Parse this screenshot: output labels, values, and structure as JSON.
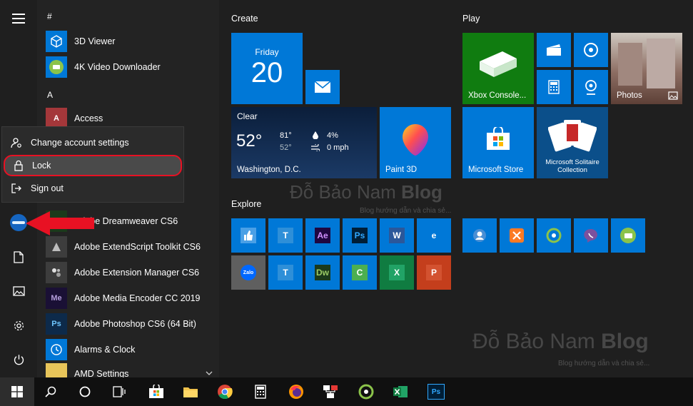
{
  "app_list": {
    "sections": {
      "hash": "#",
      "a": "A"
    },
    "items": [
      {
        "label": "3D Viewer",
        "icon": "cube-icon"
      },
      {
        "label": "4K Video Downloader",
        "icon": "download-icon"
      },
      {
        "label": "Access",
        "icon": "access-icon",
        "badge": "A"
      },
      {
        "label": "Adobe Dreamweaver CS6",
        "icon": "dreamweaver-icon",
        "badge": "Dw"
      },
      {
        "label": "Adobe ExtendScript Toolkit CS6",
        "icon": "extendscript-icon"
      },
      {
        "label": "Adobe Extension Manager CS6",
        "icon": "extension-manager-icon"
      },
      {
        "label": "Adobe Media Encoder CC 2019",
        "icon": "media-encoder-icon",
        "badge": "Me"
      },
      {
        "label": "Adobe Photoshop CS6 (64 Bit)",
        "icon": "photoshop-icon",
        "badge": "Ps"
      },
      {
        "label": "Alarms & Clock",
        "icon": "clock-icon"
      },
      {
        "label": "AMD Settings",
        "icon": "folder-icon"
      }
    ]
  },
  "account_menu": {
    "items": [
      {
        "label": "Change account settings",
        "icon": "user-settings-icon"
      },
      {
        "label": "Lock",
        "icon": "lock-icon"
      },
      {
        "label": "Sign out",
        "icon": "sign-out-icon"
      }
    ]
  },
  "groups": {
    "create": "Create",
    "play": "Play",
    "explore": "Explore"
  },
  "tiles": {
    "calendar": {
      "day_name": "Friday",
      "day_number": "20"
    },
    "weather": {
      "condition": "Clear",
      "temp": "52°",
      "high": "81°",
      "low": "52°",
      "precip": "4%",
      "wind": "0 mph",
      "location": "Washington, D.C."
    },
    "paint3d": "Paint 3D",
    "xbox": "Xbox Console...",
    "photos": "Photos",
    "store": "Microsoft Store",
    "solitaire": "Microsoft Solitaire Collection"
  },
  "explore_tiles": [
    {
      "badge": "",
      "icon": "thumbs-up-icon"
    },
    {
      "badge": "T",
      "icon": "typora-icon"
    },
    {
      "badge": "Ae",
      "icon": "after-effects-icon"
    },
    {
      "badge": "Ps",
      "icon": "photoshop-icon"
    },
    {
      "badge": "W",
      "icon": "word-icon"
    },
    {
      "badge": "e",
      "icon": "edge-icon"
    },
    {
      "badge": "Zalo",
      "icon": "zalo-icon"
    },
    {
      "badge": "T",
      "icon": "typora-icon"
    },
    {
      "badge": "Dw",
      "icon": "dreamweaver-icon"
    },
    {
      "badge": "C",
      "icon": "camtasia-icon"
    },
    {
      "badge": "X",
      "icon": "excel-icon"
    },
    {
      "badge": "P",
      "icon": "powerpoint-icon"
    }
  ],
  "watermark": {
    "name_plain": "Đỗ Bảo Nam ",
    "name_bold": "Blog",
    "tagline": "Blog hướng dẫn và chia sẻ..."
  },
  "colors": {
    "accent": "#0063b1",
    "tile_blue": "#0078d7",
    "xbox_green": "#107c10",
    "highlight_red": "#e81123"
  }
}
